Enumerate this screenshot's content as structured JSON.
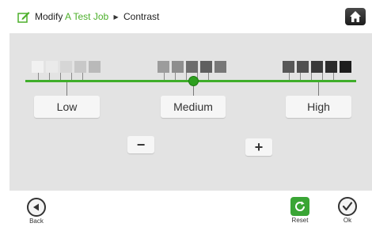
{
  "header": {
    "modify_label": "Modify",
    "job_name": "A Test Job",
    "current_page": "Contrast"
  },
  "levels": {
    "low": "Low",
    "medium": "Medium",
    "high": "High",
    "selected": "Medium"
  },
  "adjust": {
    "minus": "−",
    "plus": "+"
  },
  "swatch_groups": {
    "low": [
      "#f1f1f1",
      "#eaeaea",
      "#d6d6d6",
      "#c8c8c8",
      "#b9b9b9"
    ],
    "medium": [
      "#9c9c9c",
      "#8e8e8e",
      "#6d6d6d",
      "#5f5f5f",
      "#777777"
    ],
    "high": [
      "#575757",
      "#4f4f4f",
      "#3a3a3a",
      "#2b2b2b",
      "#1d1d1d"
    ]
  },
  "footer": {
    "back_label": "Back",
    "reset_label": "Reset",
    "ok_label": "Ok"
  },
  "colors": {
    "accent": "#3fae2a",
    "panel": "#e3e3e3"
  },
  "icons": {
    "edit": "edit-icon",
    "home": "home-icon",
    "back": "back-arrow-icon",
    "reset": "refresh-icon",
    "ok": "checkmark-icon"
  }
}
